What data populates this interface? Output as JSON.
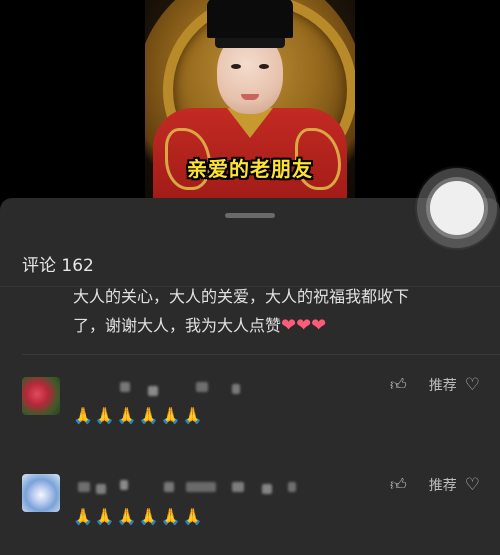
{
  "video": {
    "caption": "亲爱的老朋友"
  },
  "comments_panel": {
    "title": "评论 162",
    "previous_comment": {
      "text": "大人的关心，大人的关爱，大人的祝福我都收下了，谢谢大人，我为大人点赞",
      "emoji": "❤❤❤"
    },
    "comments": [
      {
        "avatar_icon": "flower-avatar-icon",
        "username": "",
        "text": "🙏🙏🙏🙏🙏🙏",
        "like_icon": "thumbs-up-icon",
        "recommend_label": "推荐",
        "favorite_icon": "heart-outline-icon"
      },
      {
        "avatar_icon": "lotus-avatar-icon",
        "username": "",
        "text": "🙏🙏🙏🙏🙏🙏",
        "like_icon": "thumbs-up-icon",
        "recommend_label": "推荐",
        "favorite_icon": "heart-outline-icon"
      }
    ]
  },
  "floating_button": {
    "icon": "record-circle-icon"
  },
  "colors": {
    "sheet_bg": "#2b2b2b",
    "caption": "#ffe330",
    "heart": "#ff5a78"
  }
}
